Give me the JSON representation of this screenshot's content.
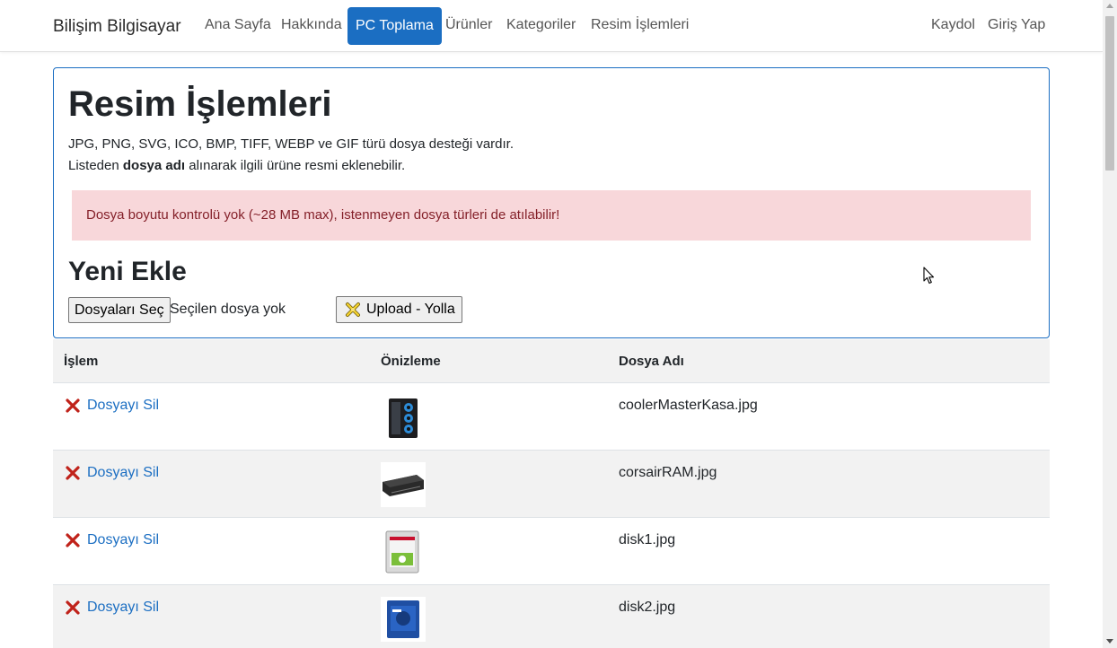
{
  "navbar": {
    "brand": "Bilişim Bilgisayar",
    "links": [
      "Ana Sayfa",
      "Hakkında",
      "PC Toplama",
      "Ürünler",
      "Kategoriler",
      "Resim İşlemleri"
    ],
    "active_link": "PC Toplama",
    "right_links": [
      "Kaydol",
      "Giriş Yap"
    ],
    "active_color": "#1b6ec2"
  },
  "panel": {
    "title": "Resim İşlemleri",
    "description": "JPG, PNG, SVG, ICO, BMP, TIFF, WEBP ve GIF türü dosya desteği vardır.",
    "hint_prefix": "Listeden ",
    "hint_bold": "dosya adı",
    "hint_suffix": " alınarak ilgili ürüne resmi eklenebilir.",
    "alert": "Dosya boyutu kontrolü yok (~28 MB max), istenmeyen dosya türleri de atılabilir!",
    "section_title": "Yeni Ekle",
    "file_button": "Dosyaları Seç",
    "file_status": "Seçilen dosya yok",
    "upload_button": "Upload - Yolla",
    "border_color": "#1b6ec2",
    "alert_bg": "#f8d7da",
    "alert_text_color": "#842029"
  },
  "table": {
    "headers": [
      "İşlem",
      "Önizleme",
      "Dosya Adı"
    ],
    "rows": [
      {
        "action": "Dosyayı Sil",
        "preview_icon": "pc-case-thumbnail",
        "filename": "coolerMasterKasa.jpg"
      },
      {
        "action": "Dosyayı Sil",
        "preview_icon": "ram-module-thumbnail",
        "filename": "corsairRAM.jpg"
      },
      {
        "action": "Dosyayı Sil",
        "preview_icon": "hard-disk-thumbnail",
        "filename": "disk1.jpg"
      },
      {
        "action": "Dosyayı Sil",
        "preview_icon": "blue-hard-disk-thumbnail",
        "filename": "disk2.jpg"
      }
    ],
    "link_color": "#1b6ec2",
    "delete_icon": "red-x-icon"
  }
}
